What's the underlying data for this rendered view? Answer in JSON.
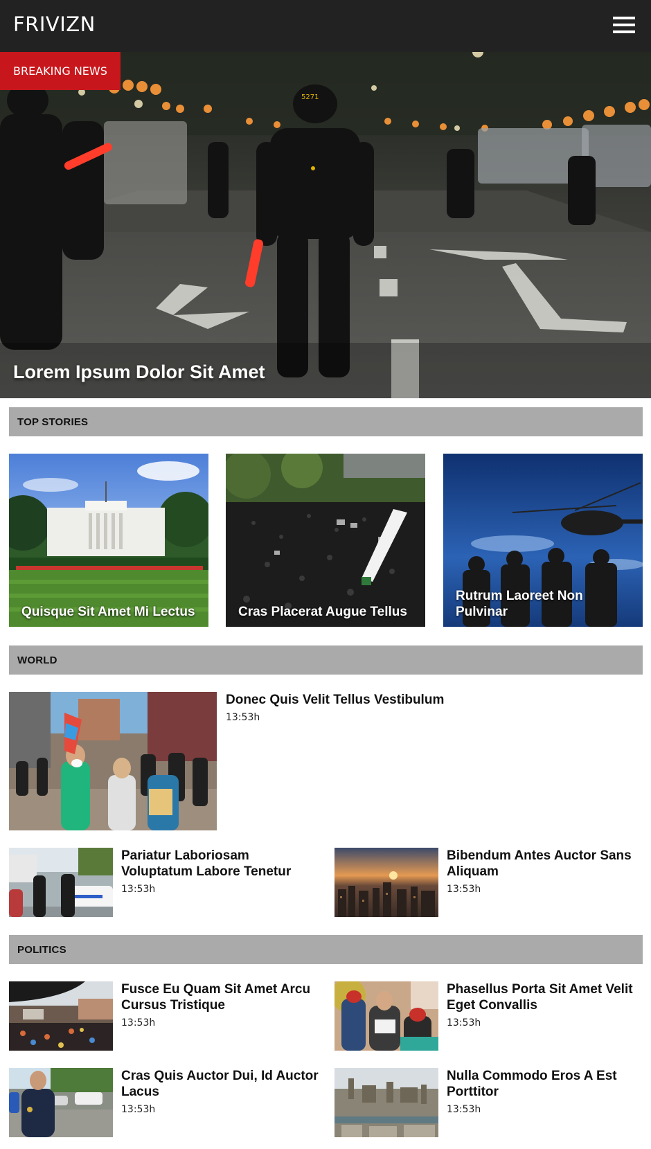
{
  "header": {
    "logo": "FRIVIZN",
    "menu_icon": "hamburger-menu-icon"
  },
  "hero": {
    "badge": "BREAKING NEWS",
    "title": "Lorem Ipsum Dolor Sit Amet"
  },
  "top_stories": {
    "label": "TOP STORIES",
    "items": [
      {
        "title": "Quisque Sit Amet Mi Lectus"
      },
      {
        "title": "Cras Placerat Augue Tellus"
      },
      {
        "title": "Rutrum Laoreet Non Pulvinar"
      }
    ]
  },
  "world": {
    "label": "WORLD",
    "featured": {
      "title": "Donec Quis Velit Tellus Vestibulum",
      "time": "13:53h"
    },
    "items": [
      {
        "title": "Pariatur Laboriosam Voluptatum Labore Tenetur",
        "time": "13:53h"
      },
      {
        "title": "Bibendum Antes Auctor Sans Aliquam",
        "time": "13:53h"
      }
    ]
  },
  "politics": {
    "label": "POLITICS",
    "items": [
      {
        "title": "Fusce Eu Quam Sit Amet Arcu Cursus Tristique",
        "time": "13:53h"
      },
      {
        "title": "Phasellus Porta Sit Amet Velit Eget Convallis",
        "time": "13:53h"
      },
      {
        "title": "Cras Quis Auctor Dui, Id Auctor Lacus",
        "time": "13:53h"
      },
      {
        "title": "Nulla Commodo Eros A Est Porttitor",
        "time": "13:53h"
      }
    ]
  }
}
